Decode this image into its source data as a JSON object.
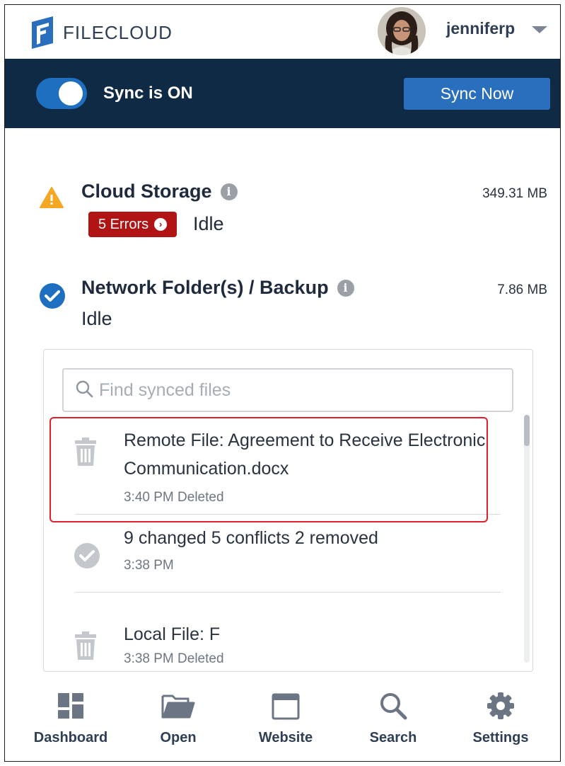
{
  "header": {
    "brand": "FILECLOUD",
    "username": "jenniferp"
  },
  "sync": {
    "status_label": "Sync is ON",
    "toggle_on": true,
    "sync_now_label": "Sync Now"
  },
  "cloud_storage": {
    "title": "Cloud Storage",
    "size": "349.31 MB",
    "errors_label": "5 Errors",
    "state": "Idle",
    "status_icon": "warning-icon"
  },
  "network_folder": {
    "title": "Network Folder(s) / Backup",
    "size": "7.86 MB",
    "state": "Idle",
    "status_icon": "check-circle-icon"
  },
  "search": {
    "placeholder": "Find synced files"
  },
  "activity": [
    {
      "icon": "trash-icon",
      "name": "Remote File: Agreement to Receive Electronic Communication.docx",
      "meta": "3:40 PM Deleted"
    },
    {
      "icon": "check-circle-icon",
      "name": "9 changed 5 conflicts 2 removed",
      "meta": "3:38 PM"
    },
    {
      "icon": "trash-icon",
      "name": "Local File: F",
      "meta": "3:38 PM Deleted"
    }
  ],
  "nav": {
    "dashboard": "Dashboard",
    "open": "Open",
    "website": "Website",
    "search": "Search",
    "settings": "Settings"
  },
  "colors": {
    "sync_bar": "#0f2a44",
    "accent": "#2a6fbd",
    "error": "#b01414",
    "warning": "#f5a623",
    "success": "#1f6fc0",
    "highlight": "#e0202a"
  }
}
